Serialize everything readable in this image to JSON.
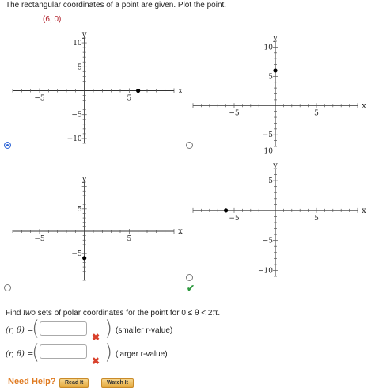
{
  "question": "The rectangular coordinates of a point are given. Plot the point.",
  "point": "(6, 0)",
  "axes": {
    "x_label": "x",
    "y_label": "y"
  },
  "options": [
    {
      "id": "A",
      "selected": true,
      "correct": false,
      "xrange": [
        -8,
        10
      ],
      "yrange": [
        -11,
        11
      ],
      "point": [
        6,
        0
      ],
      "x_ticks": [
        "−5",
        "5"
      ],
      "y_ticks": [
        "10",
        "5",
        "−5",
        "−10"
      ]
    },
    {
      "id": "B",
      "selected": false,
      "correct": false,
      "xrange": [
        -10,
        10
      ],
      "yrange": [
        -7,
        11
      ],
      "point": [
        0,
        6
      ],
      "x_ticks": [
        "−5",
        "5"
      ],
      "y_ticks": [
        "10",
        "5",
        "−5"
      ]
    },
    {
      "id": "C",
      "selected": false,
      "correct": false,
      "xrange": [
        -8,
        10
      ],
      "yrange": [
        -11,
        11
      ],
      "point": [
        0,
        -6
      ],
      "x_ticks": [
        "−5",
        "5"
      ],
      "y_ticks": [
        "5",
        "−5"
      ]
    },
    {
      "id": "D",
      "selected": false,
      "correct": true,
      "xrange": [
        -10,
        10
      ],
      "yrange": [
        -11,
        7
      ],
      "point": [
        -6,
        0
      ],
      "x_ticks": [
        "−5",
        "5"
      ],
      "y_ticks": [
        "10",
        "5",
        "−5",
        "−10"
      ]
    }
  ],
  "polar": {
    "prompt_pre": "Find ",
    "prompt_em": "two",
    "prompt_post": " sets of polar coordinates for the point for 0 ≤ θ < 2π.",
    "row_label": "(r, θ) =",
    "row1_value": "",
    "row1_desc": "(smaller r-value)",
    "row2_value": "",
    "row2_desc": "(larger r-value)"
  },
  "help": {
    "need_help": "Need Help?",
    "read_it": "Read It",
    "watch_it": "Watch It"
  },
  "colors": {
    "selected_radio": "#2f66d6",
    "check": "#2e9a3f",
    "wrong": "#d9412c",
    "point": "#b0202a"
  }
}
